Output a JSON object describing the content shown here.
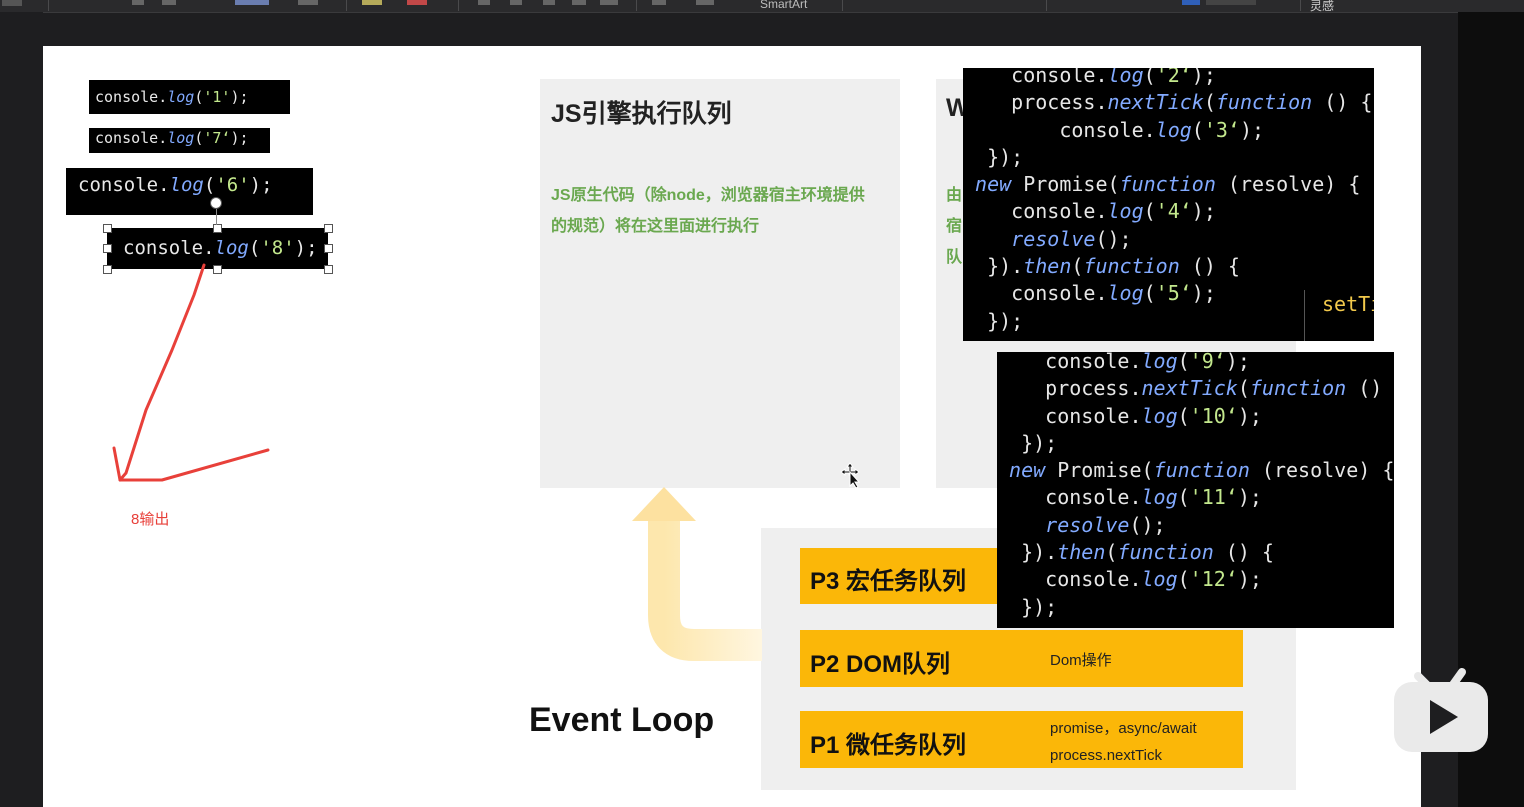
{
  "toolbar": {
    "smartart_label": "SmartArt",
    "inspiration_label": "灵感"
  },
  "snippets": {
    "s1": {
      "obj": "console",
      "fn": "log",
      "arg": "'1'",
      "end": ");"
    },
    "s7": {
      "obj": "console",
      "fn": "log",
      "arg": "'7‘",
      "end": ");"
    },
    "s6": {
      "obj": "console",
      "fn": "log",
      "arg": "'6'",
      "end": ");"
    },
    "s8": {
      "obj": "console",
      "fn": "log",
      "arg": "'8'",
      "end": ");"
    }
  },
  "annotation": {
    "text": "8输出",
    "color": "#e8403a"
  },
  "js_panel": {
    "title": "JS引擎执行队列",
    "desc_line1": "JS原生代码（除node，浏览器宿主环境提供",
    "desc_line2": "的规范）将在这里面进行执行"
  },
  "web_panel": {
    "title_visible": "W",
    "desc_visible": [
      "由",
      "宿",
      "队"
    ]
  },
  "queues": {
    "p3": {
      "label": "P3 宏任务队列"
    },
    "p2": {
      "label": "P2 DOM队列",
      "note": "Dom操作"
    },
    "p1": {
      "label": "P1 微任务队列",
      "note_line1": "promise，async/await",
      "note_line2": "process.nextTick"
    }
  },
  "event_loop_label": "Event Loop",
  "code_block_1": {
    "lines": [
      "    console.log('2‘);",
      "    process.nextTick(function () {",
      "        console.log('3‘);",
      "  });",
      " new Promise(function (resolve) {",
      "    console.log('4‘);",
      "    resolve();",
      "  }).then(function () {",
      "    console.log('5‘);",
      "  });"
    ],
    "side_text": "setTi"
  },
  "code_block_2": {
    "lines": [
      "    console.log('9‘);",
      "    process.nextTick(function () {",
      "    console.log('10‘);",
      "  });",
      " new Promise(function (resolve) {",
      "    console.log('11‘);",
      "    resolve();",
      "  }).then(function () {",
      "    console.log('12‘);",
      "  });"
    ]
  },
  "colors": {
    "queue_bar": "#fbb708",
    "panel_bg": "#efefef",
    "desc_green": "#6aa84f",
    "arrow": "#fde3a0"
  }
}
